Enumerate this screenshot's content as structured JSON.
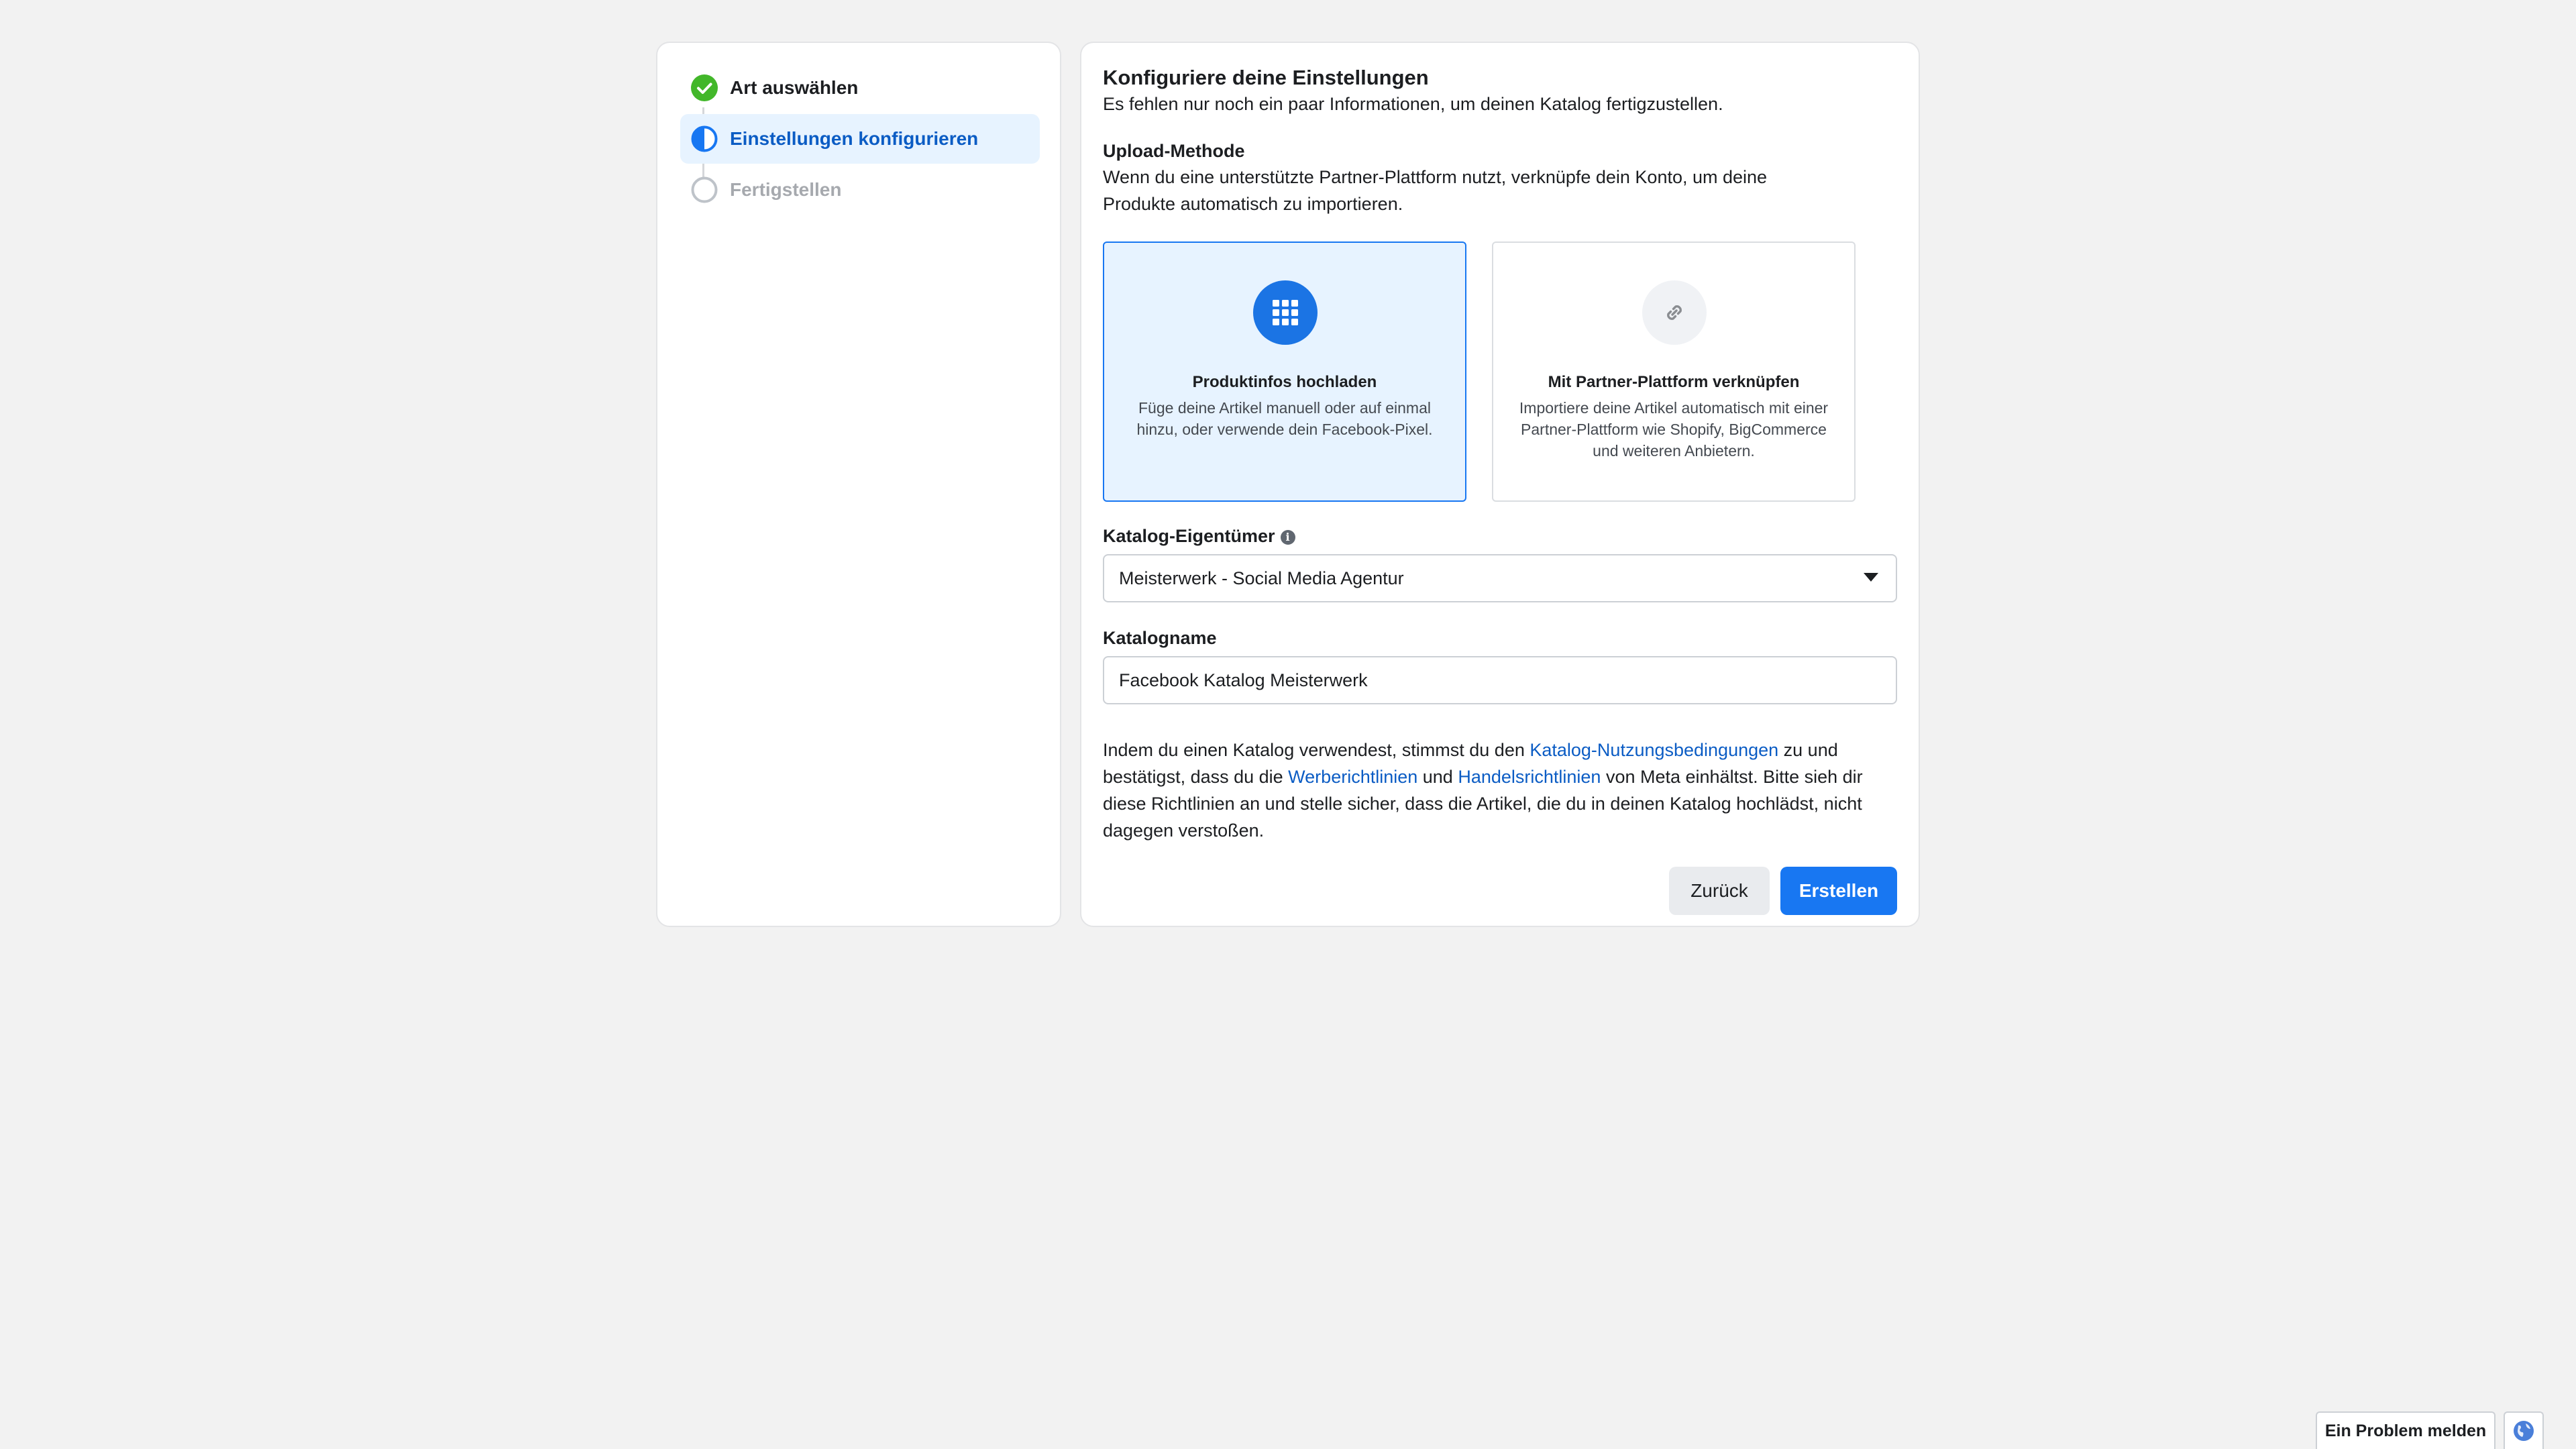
{
  "stepper": {
    "steps": [
      {
        "label": "Art auswählen",
        "state": "done",
        "icon": "check-circle-icon"
      },
      {
        "label": "Einstellungen konfigurieren",
        "state": "active",
        "icon": "half-circle-icon"
      },
      {
        "label": "Fertigstellen",
        "state": "pending",
        "icon": "empty-circle-icon"
      }
    ]
  },
  "settings": {
    "title": "Konfiguriere deine Einstellungen",
    "subtitle": "Es fehlen nur noch ein paar Informationen, um deinen Katalog fertigzustellen.",
    "upload": {
      "label": "Upload-Methode",
      "description": "Wenn du eine unterstützte Partner-Plattform nutzt, verknüpfe dein Konto, um deine Produkte automatisch zu importieren.",
      "options": [
        {
          "title": "Produktinfos hochladen",
          "description": "Füge deine Artikel manuell oder auf einmal hinzu, oder verwende dein Facebook-Pixel.",
          "icon": "grid-icon",
          "selected": true
        },
        {
          "title": "Mit Partner-Plattform verknüpfen",
          "description": "Importiere deine Artikel automatisch mit einer Partner-Plattform wie Shopify, BigCommerce und weiteren Anbietern.",
          "icon": "link-icon",
          "selected": false
        }
      ]
    },
    "owner": {
      "label": "Katalog-Eigentümer",
      "info_icon": "info-icon",
      "value": "Meisterwerk - Social Media Agentur"
    },
    "catalog_name": {
      "label": "Katalogname",
      "value": "Facebook Katalog Meisterwerk"
    },
    "terms": {
      "part1": "Indem du einen Katalog verwendest, stimmst du den ",
      "link1": "Katalog-Nutzungsbedingungen",
      "part2": " zu und bestätigst, dass du die ",
      "link2": "Werberichtlinien",
      "part3": " und ",
      "link3": "Handelsrichtlinien",
      "part4": " von Meta einhältst. Bitte sieh dir diese Richtlinien an und stelle sicher, dass die Artikel, die du in deinen Katalog hochlädst, nicht dagegen verstoßen."
    },
    "buttons": {
      "back": "Zurück",
      "create": "Erstellen"
    }
  },
  "footer": {
    "report_problem": "Ein Problem melden",
    "language_icon": "globe-icon"
  },
  "colors": {
    "accent": "#1877f2",
    "success": "#42b72a",
    "link": "#0b5cc4",
    "background": "#f2f2f2"
  }
}
